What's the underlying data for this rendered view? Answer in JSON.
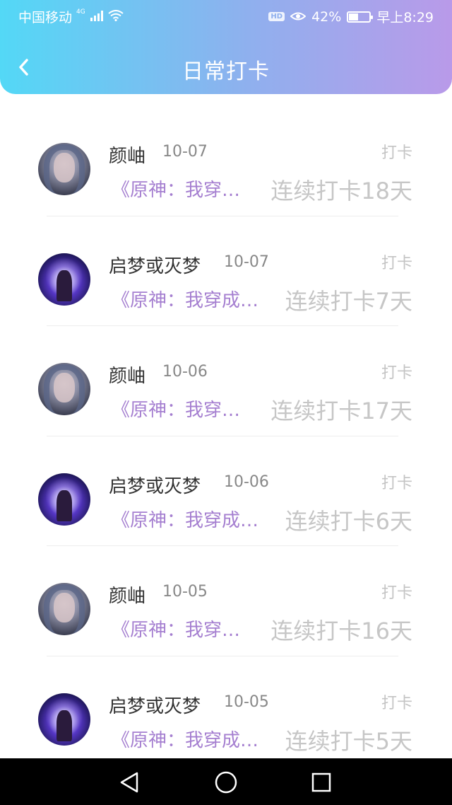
{
  "status_bar": {
    "carrier": "中国移动",
    "network": "4G",
    "hd": "HD",
    "battery": "42%",
    "time": "早上8:29"
  },
  "header": {
    "title": "日常打卡",
    "back_icon": "chevron-left-icon"
  },
  "colors": {
    "header_gradient": [
      "#53d8f6",
      "#8fb0ee",
      "#b99ae9"
    ],
    "book_text": "#a57fd0",
    "streak_text": "#c6c6c6"
  },
  "records": [
    {
      "name": "颜岫",
      "date": "10-07",
      "action": "打卡",
      "book": "《原神：我穿…",
      "streak": "连续打卡18天",
      "avatar": "girl-avatar"
    },
    {
      "name": "启梦或灭梦",
      "date": "10-07",
      "action": "打卡",
      "book": "《原神：我穿成…",
      "streak": "连续打卡7天",
      "avatar": "glow-avatar"
    },
    {
      "name": "颜岫",
      "date": "10-06",
      "action": "打卡",
      "book": "《原神：我穿…",
      "streak": "连续打卡17天",
      "avatar": "girl-avatar"
    },
    {
      "name": "启梦或灭梦",
      "date": "10-06",
      "action": "打卡",
      "book": "《原神：我穿成…",
      "streak": "连续打卡6天",
      "avatar": "glow-avatar"
    },
    {
      "name": "颜岫",
      "date": "10-05",
      "action": "打卡",
      "book": "《原神：我穿…",
      "streak": "连续打卡16天",
      "avatar": "girl-avatar"
    },
    {
      "name": "启梦或灭梦",
      "date": "10-05",
      "action": "打卡",
      "book": "《原神：我穿成…",
      "streak": "连续打卡5天",
      "avatar": "glow-avatar"
    }
  ],
  "system_nav": [
    "back-triangle-icon",
    "home-circle-icon",
    "recents-square-icon"
  ]
}
